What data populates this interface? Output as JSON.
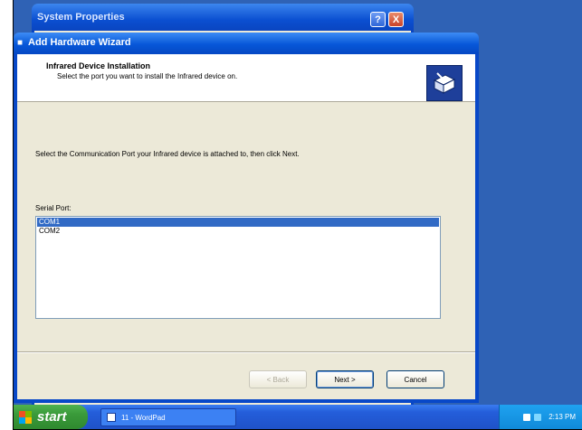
{
  "background_window": {
    "title": "System Properties",
    "help_label": "?",
    "close_label": "X"
  },
  "wizard": {
    "title": "Add Hardware Wizard",
    "header_title": "Infrared Device Installation",
    "header_subtitle": "Select the port you want to install the Infrared device on.",
    "instruction": "Select the Communication Port your Infrared device is attached to, then click Next.",
    "list_label": "Serial Port:",
    "ports": [
      {
        "label": "COM1",
        "selected": true
      },
      {
        "label": "COM2",
        "selected": false
      }
    ],
    "back_label": "< Back",
    "next_label": "Next >",
    "cancel_label": "Cancel"
  },
  "taskbar": {
    "start_label": "start",
    "task_label": "11 - WordPad",
    "clock": "2:13 PM"
  },
  "colors": {
    "desktop": "#2f62b5",
    "title_blue": "#0757d8",
    "selection": "#316ac5",
    "dialog_bg": "#ece9d8",
    "start_green": "#3a9a3a"
  }
}
